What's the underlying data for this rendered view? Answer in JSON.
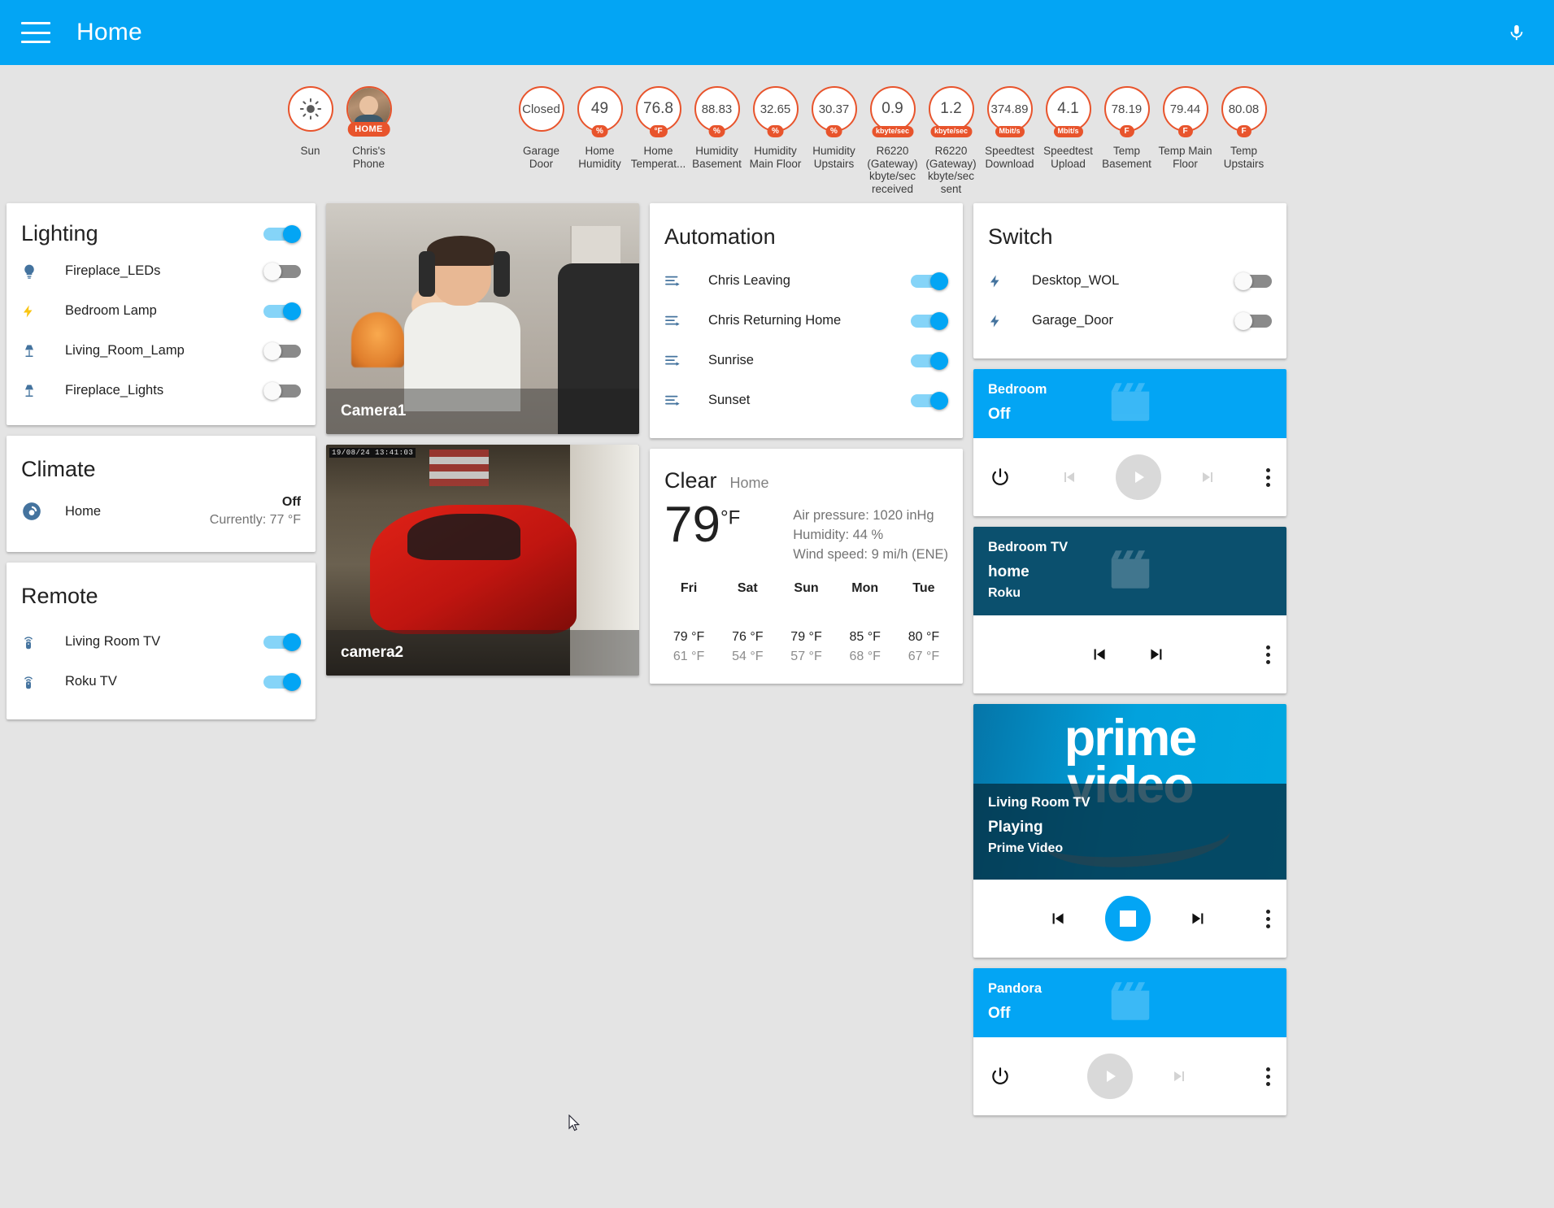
{
  "appbar": {
    "title": "Home",
    "menu_icon": "hamburger-menu-icon",
    "mic_icon": "microphone-icon"
  },
  "badges": [
    {
      "value": "",
      "unit": "",
      "label": "Sun",
      "icon": "sun-icon",
      "type": "icon"
    },
    {
      "value": "HOME",
      "unit": "",
      "label": "Chris's Phone",
      "icon": "person-avatar",
      "type": "avatar"
    },
    {
      "value": "Closed",
      "unit": "",
      "label": "Garage Door",
      "type": "text"
    },
    {
      "value": "49",
      "unit": "%",
      "label": "Home Humidity",
      "type": "number"
    },
    {
      "value": "76.8",
      "unit": "°F",
      "label": "Home Temperat...",
      "type": "number"
    },
    {
      "value": "88.83",
      "unit": "%",
      "label": "Humidity Basement",
      "type": "number"
    },
    {
      "value": "32.65",
      "unit": "%",
      "label": "Humidity Main Floor",
      "type": "number"
    },
    {
      "value": "30.37",
      "unit": "%",
      "label": "Humidity Upstairs",
      "type": "number"
    },
    {
      "value": "0.9",
      "unit": "kbyte/sec",
      "label": "R6220 (Gateway) kbyte/sec received",
      "type": "number"
    },
    {
      "value": "1.2",
      "unit": "kbyte/sec",
      "label": "R6220 (Gateway) kbyte/sec sent",
      "type": "number"
    },
    {
      "value": "374.89",
      "unit": "Mbit/s",
      "label": "Speedtest Download",
      "type": "number"
    },
    {
      "value": "4.1",
      "unit": "Mbit/s",
      "label": "Speedtest Upload",
      "type": "number"
    },
    {
      "value": "78.19",
      "unit": "F",
      "label": "Temp Basement",
      "type": "number"
    },
    {
      "value": "79.44",
      "unit": "F",
      "label": "Temp Main Floor",
      "type": "number"
    },
    {
      "value": "80.08",
      "unit": "F",
      "label": "Temp Upstairs",
      "type": "number"
    }
  ],
  "lighting": {
    "title": "Lighting",
    "master_toggle": "on",
    "items": [
      {
        "name": "Fireplace_LEDs",
        "icon": "lightbulb-icon",
        "state": "off"
      },
      {
        "name": "Bedroom Lamp",
        "icon": "lightning-bolt-icon",
        "state": "on"
      },
      {
        "name": "Living_Room_Lamp",
        "icon": "table-lamp-icon",
        "state": "off"
      },
      {
        "name": "Fireplace_Lights",
        "icon": "table-lamp-icon",
        "state": "off"
      }
    ]
  },
  "climate": {
    "title": "Climate",
    "name": "Home",
    "icon": "thermostat-icon",
    "state": "Off",
    "current": "Currently: 77 °F"
  },
  "remote": {
    "title": "Remote",
    "items": [
      {
        "name": "Living Room TV",
        "icon": "remote-control-icon",
        "state": "on"
      },
      {
        "name": "Roku TV",
        "icon": "remote-control-icon",
        "state": "on"
      }
    ]
  },
  "cameras": [
    {
      "label": "Camera1",
      "timestamp": ""
    },
    {
      "label": "camera2",
      "timestamp": "19/08/24  13:41:03"
    }
  ],
  "automation": {
    "title": "Automation",
    "items": [
      {
        "name": "Chris Leaving",
        "icon": "script-icon",
        "state": "on"
      },
      {
        "name": "Chris Returning Home",
        "icon": "script-icon",
        "state": "on"
      },
      {
        "name": "Sunrise",
        "icon": "script-icon",
        "state": "on"
      },
      {
        "name": "Sunset",
        "icon": "script-icon",
        "state": "on"
      }
    ]
  },
  "weather": {
    "condition": "Clear",
    "location": "Home",
    "temperature": "79",
    "temperature_unit": "°F",
    "attributes": [
      "Air pressure: 1020 inHg",
      "Humidity: 44 %",
      "Wind speed: 9 mi/h (ENE)"
    ],
    "forecast": [
      {
        "day": "Fri",
        "high": "79 °F",
        "low": "61 °F"
      },
      {
        "day": "Sat",
        "high": "76 °F",
        "low": "54 °F"
      },
      {
        "day": "Sun",
        "high": "79 °F",
        "low": "57 °F"
      },
      {
        "day": "Mon",
        "high": "85 °F",
        "low": "68 °F"
      },
      {
        "day": "Tue",
        "high": "80 °F",
        "low": "67 °F"
      }
    ]
  },
  "switch": {
    "title": "Switch",
    "items": [
      {
        "name": "Desktop_WOL",
        "icon": "lightning-bolt-icon",
        "state": "off"
      },
      {
        "name": "Garage_Door",
        "icon": "lightning-bolt-icon",
        "state": "off"
      }
    ]
  },
  "media_players": [
    {
      "title": "Bedroom",
      "state": "Off",
      "source": "",
      "banner_style": "blue",
      "has_power": true,
      "play_active": false,
      "play_icon": "play-icon",
      "prev_icon": "skip-previous-icon",
      "next_icon": "skip-next-icon",
      "menu_icon": "more-vertical-icon",
      "power_icon": "power-icon",
      "art_icon": "music-album-icon"
    },
    {
      "title": "Bedroom TV",
      "state": "home",
      "source": "Roku",
      "banner_style": "dark",
      "has_power": false,
      "play_active": false,
      "play_icon": "",
      "prev_icon": "skip-previous-icon",
      "next_icon": "skip-next-icon",
      "menu_icon": "more-vertical-icon",
      "art_icon": "music-album-icon"
    },
    {
      "title": "Living Room TV",
      "state": "Playing",
      "source": "Prime Video",
      "banner_style": "prime",
      "logo_line1": "prime",
      "logo_line2": "video",
      "has_power": false,
      "play_active": true,
      "play_icon": "stop-icon",
      "prev_icon": "skip-previous-icon",
      "next_icon": "skip-next-icon",
      "menu_icon": "more-vertical-icon"
    },
    {
      "title": "Pandora",
      "state": "Off",
      "source": "",
      "banner_style": "blue",
      "has_power": true,
      "play_active": false,
      "play_icon": "play-icon",
      "prev_icon": "",
      "next_icon": "skip-next-icon",
      "menu_icon": "more-vertical-icon",
      "power_icon": "power-icon",
      "art_icon": "music-album-icon"
    }
  ],
  "colors": {
    "accent": "#03a5f4",
    "badge_accent": "#e8542c",
    "background": "#e4e4e4",
    "media_dark": "#0b506e"
  }
}
